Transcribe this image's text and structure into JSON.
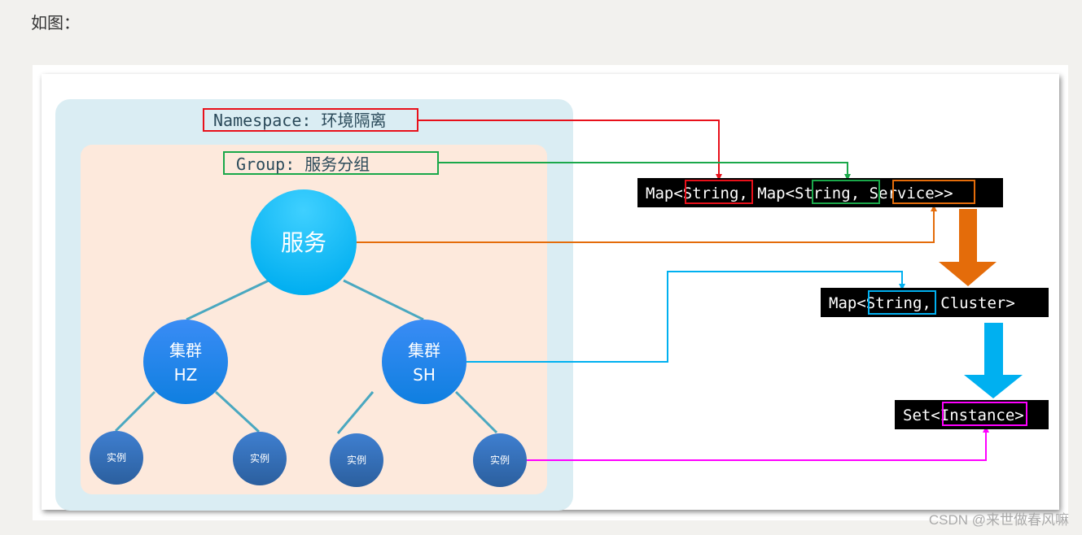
{
  "intro_text": "如图：",
  "watermark": "CSDN @来世做春风嘛",
  "diagram": {
    "namespace_label": "Namespace: 环境隔离",
    "group_label": "Group: 服务分组",
    "service_node": "服务",
    "clusters": [
      {
        "line1": "集群",
        "line2": "HZ"
      },
      {
        "line1": "集群",
        "line2": "SH"
      }
    ],
    "instances": [
      "实例",
      "实例",
      "实例",
      "实例"
    ],
    "code_boxes": {
      "outer_map": {
        "prefix": "Map<",
        "key1": "String",
        "mid": ", Map<",
        "key2": "String",
        "sep": ", ",
        "value": "Service",
        "suffix": ">>"
      },
      "cluster_map": {
        "prefix": "Map<",
        "key": "String",
        "sep": ", ",
        "value": "Cluster",
        "suffix": ">"
      },
      "instance_set": {
        "prefix": "Set<",
        "value": "Instance",
        "suffix": ">"
      }
    },
    "colors": {
      "namespace": "#e8101a",
      "group": "#1aa84a",
      "service": "#e46c0a",
      "cluster": "#00b0f0",
      "instance": "#ff00ff",
      "namespace_bg": "#daedf3",
      "group_bg": "#fde9dc"
    }
  }
}
